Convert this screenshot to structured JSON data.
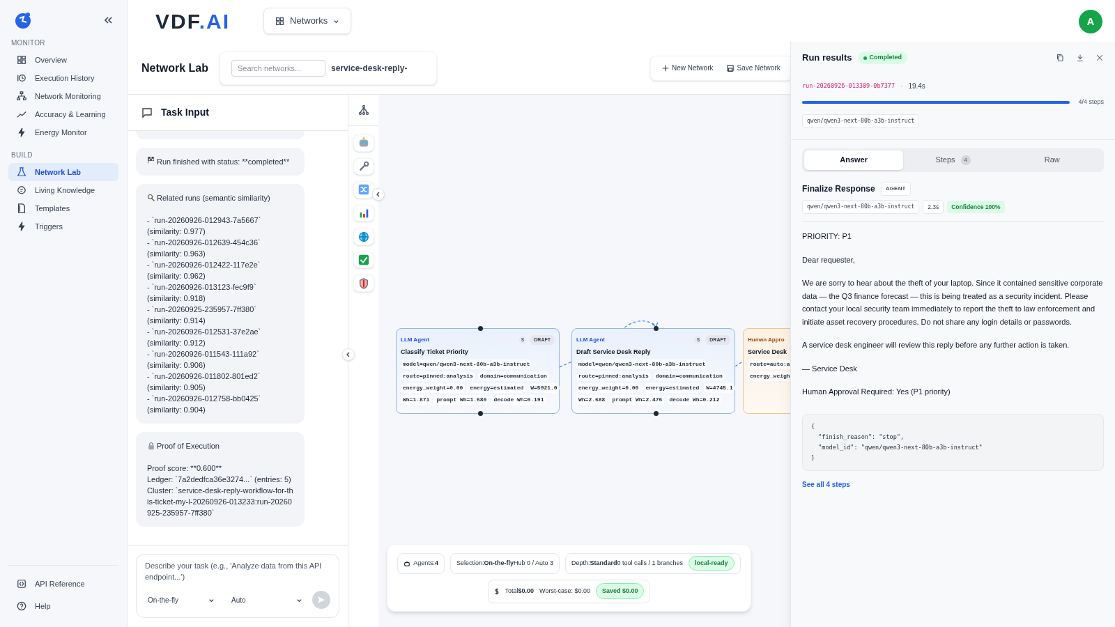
{
  "sidebar": {
    "sections": [
      {
        "title": "MONITOR",
        "items": [
          {
            "label": "Overview",
            "selected": false
          },
          {
            "label": "Execution History",
            "selected": false
          },
          {
            "label": "Network Monitoring",
            "selected": false
          },
          {
            "label": "Accuracy & Learning",
            "selected": false
          },
          {
            "label": "Energy Monitor",
            "selected": false
          }
        ]
      },
      {
        "title": "BUILD",
        "items": [
          {
            "label": "Network Lab",
            "selected": true
          },
          {
            "label": "Living Knowledge",
            "selected": false
          },
          {
            "label": "Templates",
            "selected": false
          },
          {
            "label": "Triggers",
            "selected": false
          }
        ]
      }
    ],
    "footer": [
      {
        "label": "API Reference"
      },
      {
        "label": "Help"
      }
    ]
  },
  "header": {
    "logo": {
      "dark": "VDF",
      "accent": ".AI"
    },
    "networks_button": "Networks",
    "avatar": "A"
  },
  "page": {
    "title": "Network Lab",
    "search": {
      "placeholder": "Search networks..."
    },
    "network_name": "service-desk-reply-",
    "actions": [
      "New Network",
      "Save Network"
    ]
  },
  "task_input": {
    "title": "Task Input",
    "messages": [
      {
        "kind": "status",
        "text": "Run finished with status: **completed**"
      },
      {
        "kind": "related",
        "title": "Related runs (semantic similarity)",
        "runs": [
          {
            "run": "- `run-20260926-012943-7a5667`",
            "similarity": "(similarity: 0.977)"
          },
          {
            "run": "- `run-20260926-012639-454c36`",
            "similarity": "(similarity: 0.963)"
          },
          {
            "run": "- `run-20260926-012422-117e2e`",
            "similarity": "(similarity: 0.962)"
          },
          {
            "run": "- `run-20260926-013123-fec9f9`",
            "similarity": "(similarity: 0.918)"
          },
          {
            "run": "- `run-20260925-235957-7ff380`",
            "similarity": "(similarity: 0.914)"
          },
          {
            "run": "- `run-20260926-012531-37e2ae`",
            "similarity": "(similarity: 0.912)"
          },
          {
            "run": "- `run-20260926-011543-111a92`",
            "similarity": "(similarity: 0.906)"
          },
          {
            "run": "- `run-20260926-011802-801ed2`",
            "similarity": "(similarity: 0.905)"
          },
          {
            "run": "- `run-20260926-012758-bb0425`",
            "similarity": "(similarity: 0.904)"
          }
        ]
      },
      {
        "kind": "proof",
        "title": "Proof of Execution",
        "lines": [
          "Proof score: **0.600**",
          "Ledger: `7a2dedfca36e3274...` (entries: 5)",
          "Cluster: `service-desk-reply-workflow-for-this-ticket-my-l-20260926-013233:run-20260925-235957-7ff380`"
        ]
      }
    ],
    "composer": {
      "placeholder": "Describe your task (e.g., 'Analyze data from this API endpoint...')",
      "mode": "On-the-fly",
      "model": "Auto"
    }
  },
  "canvas": {
    "nodes": [
      {
        "kind": "llm",
        "type": "LLM Agent",
        "badge": "DRAFT",
        "cost": "$",
        "title": "Classify Ticket Priority",
        "chips": [
          [
            "model=qwen/qwen3-next-80b-a3b-instruct"
          ],
          [
            "route=pinned:analysis",
            "domain=communication"
          ],
          [
            "energy_weight=0.00",
            "energy=estimated",
            "W=5921.0"
          ],
          [
            "Wh=1.871",
            "prompt Wh=1.680",
            "decode Wh=0.191"
          ]
        ]
      },
      {
        "kind": "llm",
        "type": "LLM Agent",
        "badge": "DRAFT",
        "cost": "$",
        "title": "Draft Service Desk Reply",
        "chips": [
          [
            "model=qwen/qwen3-next-80b-a3b-instruct"
          ],
          [
            "route=pinned:analysis",
            "domain=communication"
          ],
          [
            "energy_weight=0.00",
            "energy=estimated",
            "W=4745.1"
          ],
          [
            "Wh=2.688",
            "prompt Wh=2.476",
            "decode Wh=0.212"
          ]
        ]
      },
      {
        "kind": "human",
        "type": "Human Appro",
        "title": "Service Desk",
        "chips": [
          [
            "route=auto:a"
          ],
          [
            "energy_weigh"
          ]
        ]
      }
    ],
    "stats": {
      "chips": [
        {
          "kind": "agents",
          "text": "Agents:**4**"
        },
        {
          "kind": "plain",
          "text": "Selection:**On-the-fly**Hub 0 / Auto 3"
        },
        {
          "kind": "plain",
          "text": "Depth:**Standard**0 tool calls / 1 branches"
        }
      ],
      "status_badge": "local-ready",
      "cost": {
        "total": "Total**$0.00**",
        "worst": "Worst-case: $0.00",
        "saved": "Saved $0.00"
      }
    }
  },
  "run_results": {
    "title": "Run results",
    "status": "Completed",
    "run_id": "run-20260926-013309-0b7377",
    "separator": "·",
    "duration": "19.4s",
    "progress": {
      "level": 1.0,
      "label": "4/4 steps"
    },
    "model": "qwen/qwen3-next-80b-a3b-instruct",
    "tabs": [
      {
        "label": "Answer",
        "selected": true
      },
      {
        "label": "Steps",
        "count": "4",
        "selected": false
      },
      {
        "label": "Raw",
        "selected": false
      }
    ],
    "step": {
      "title": "Finalize Response",
      "tag": "AGENT",
      "model": "qwen/qwen3-next-80b-a3b-instruct",
      "time": "2.3s",
      "confidence": "Confidence 100%"
    },
    "answer": [
      "PRIORITY: P1",
      "Dear requester,",
      "We are sorry to hear about the theft of your laptop. Since it contained sensitive corporate data — the Q3 finance forecast — this is being treated as a security incident. Please contact your local security team immediately to report the theft to law enforcement and initiate asset recovery procedures. Do not share any login details or passwords.",
      "A service desk engineer will review this reply before any further action is taken.",
      "— Service Desk",
      "Human Approval Required: Yes (P1 priority)"
    ],
    "code": [
      "{",
      "  \"finish_reason\": \"stop\",",
      "  \"model_id\": \"qwen/qwen3-next-80b-a3b-instruct\"",
      "}"
    ],
    "link": "See all 4 steps"
  }
}
